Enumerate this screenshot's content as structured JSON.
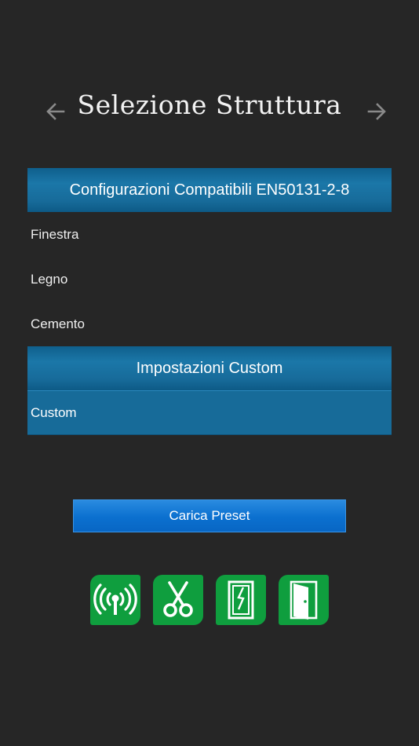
{
  "header": {
    "title": "Selezione Struttura",
    "back_icon": "arrow-left-icon",
    "forward_icon": "arrow-right-icon"
  },
  "sections": [
    {
      "title": "Configurazioni Compatibili EN50131-2-8",
      "items": [
        "Finestra",
        "Legno",
        "Cemento"
      ]
    },
    {
      "title": "Impostazioni Custom",
      "items": [
        "Custom"
      ],
      "selected": "Custom"
    }
  ],
  "actions": {
    "load_preset": "Carica Preset"
  },
  "tools": [
    {
      "icon": "wireless-signal-icon"
    },
    {
      "icon": "scissors-icon"
    },
    {
      "icon": "window-shock-icon"
    },
    {
      "icon": "door-icon"
    }
  ],
  "colors": {
    "background": "#262626",
    "section_header": "#176b9a",
    "selected_item": "#176b99",
    "button": "#0b70cf",
    "tool_tile": "#0f9e3e"
  }
}
